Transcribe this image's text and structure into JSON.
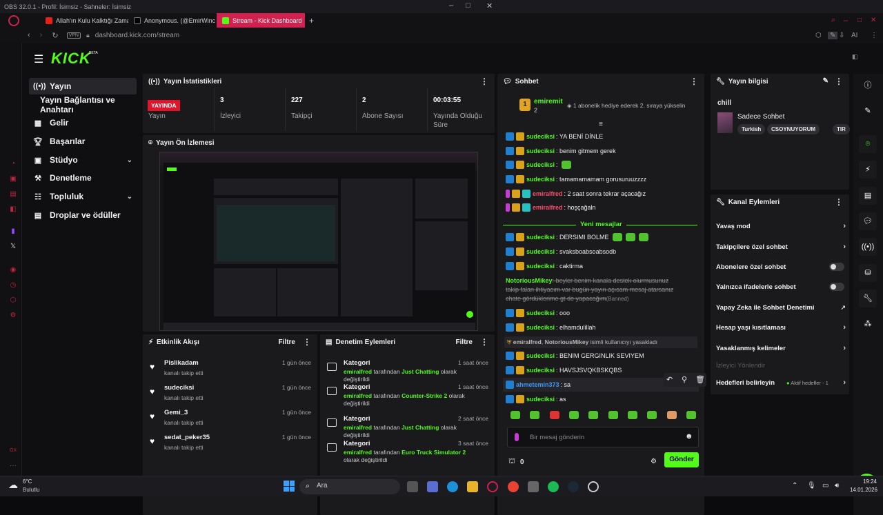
{
  "obs": {
    "title": "OBS 32.0.1 - Profil: İsimsiz - Sahneler: İsimsiz"
  },
  "browser": {
    "tabs": [
      {
        "label": "Allah'ın Kulu Kalktığı Zama"
      },
      {
        "label": "Anonymous. (@EmirWinc"
      },
      {
        "label": "Stream - Kick Dashboard"
      }
    ],
    "vpn": "VPN",
    "url": "dashboard.kick.com/stream",
    "ai": "AI"
  },
  "brand": {
    "logo": "KICK",
    "beta": "BETA",
    "accent": "#53fc18"
  },
  "sidebar": {
    "items": [
      {
        "label": "Yayın",
        "icon": "broadcast-icon"
      },
      {
        "label": "Yayın Bağlantısı ve Anahtarı"
      },
      {
        "label": "Gelir",
        "icon": "chart-icon"
      },
      {
        "label": "Başarılar",
        "icon": "trophy-icon"
      },
      {
        "label": "Stüdyo",
        "icon": "grid-icon"
      },
      {
        "label": "Denetleme",
        "icon": "hammer-icon"
      },
      {
        "label": "Topluluk",
        "icon": "community-icon"
      },
      {
        "label": "Droplar ve ödüller",
        "icon": "gift-icon"
      }
    ]
  },
  "stats": {
    "title": "Yayın İstatistikleri",
    "live_badge": "YAYINDA",
    "live_label": "Yayın",
    "items": [
      {
        "value": "3",
        "label": "İzleyici"
      },
      {
        "value": "227",
        "label": "Takipçi"
      },
      {
        "value": "2",
        "label": "Abone Sayısı"
      },
      {
        "value": "00:03:55",
        "label": "Yayında Olduğu Süre"
      }
    ]
  },
  "preview": {
    "title": "Yayın Ön İzlemesi"
  },
  "chat": {
    "title": "Sohbet",
    "pinned": {
      "user": "emiremit",
      "count": "2",
      "text": "1 abonelik hediye ederek 2. sıraya yükselin"
    },
    "new_messages": "Yeni mesajlar",
    "messages": [
      {
        "user": "sudeciksi",
        "text": ": YA BENİ DİNLE"
      },
      {
        "user": "sudeciksi",
        "text": ": benim gitmem gerek"
      },
      {
        "user": "sudeciksi",
        "text": ":"
      },
      {
        "user": "sudeciksi",
        "text": ": tamamamamam gorusuruuzzzz"
      },
      {
        "user": "emiralfred",
        "text": ": 2 saat sonra tekrar açacağız"
      },
      {
        "user": "emiralfred",
        "text": ": hoşçağaln"
      },
      {
        "user": "sudeciksi",
        "text": ": DERSIMI BOLME"
      },
      {
        "user": "sudeciksi",
        "text": ": svaksboabsoabsodb"
      },
      {
        "user": "sudeciksi",
        "text": ": caktirma"
      },
      {
        "user": "NotoriousMikey",
        "text": ": beyler benim kanala destek olurmusunuz takip falan ihtiyacım var bugün yayın açıcam mesaj atarsanız chate gördüklerime gt de yapacağım",
        "tag": "(Banned)"
      },
      {
        "user": "sudeciksi",
        "text": ": ooo"
      },
      {
        "user": "sudeciksi",
        "text": ": elhamdulillah"
      },
      {
        "user": "sudeciksi",
        "text": ": BENIM GERGINLIK SEVIYEM"
      },
      {
        "user": "sudeciksi",
        "text": ": HAVSJSVQKBSKQBS"
      },
      {
        "user": "ahmetemin373",
        "text": ": sa"
      },
      {
        "user": "sudeciksi",
        "text": ": as"
      }
    ],
    "system": {
      "user1": "emiralfred",
      "sep": ", ",
      "user2": "NotoriousMikey",
      "text": " isimli kullanıcıyı yasakladı"
    },
    "input_placeholder": "Bir mesaj gönderin",
    "points": "0",
    "send": "Gönder"
  },
  "info": {
    "title": "Yayın bilgisi",
    "stream_title": "chill",
    "category": "Sadece Sohbet",
    "tags": [
      "Turkish",
      "CSOYNUYORUM",
      "TIR"
    ]
  },
  "channel": {
    "title": "Kanal Eylemleri",
    "items": [
      {
        "label": "Yavaş mod"
      },
      {
        "label": "Takipçilere özel sohbet"
      },
      {
        "label": "Abonelere özel sohbet"
      },
      {
        "label": "Yalnızca ifadelerle sohbet"
      },
      {
        "label": "Yapay Zeka ile Sohbet Denetimi"
      },
      {
        "label": "Hesap yaşı kısıtlaması"
      },
      {
        "label": "Yasaklanmış kelimeler"
      },
      {
        "label": "İzleyici Yönlendir"
      },
      {
        "label": "Hedefleri belirleyin"
      }
    ],
    "goals_status": "Aktif hedefler - 1"
  },
  "feed": {
    "title": "Etkinlik Akışı",
    "filter": "Filtre",
    "items": [
      {
        "user": "Pislikadam",
        "action": "kanalı takip etti",
        "time": "1 gün önce"
      },
      {
        "user": "sudeciksi",
        "action": "kanalı takip etti",
        "time": "1 gün önce"
      },
      {
        "user": "Gemi_3",
        "action": "kanalı takip etti",
        "time": "1 gün önce"
      },
      {
        "user": "sedat_peker35",
        "action": "kanalı takip etti",
        "time": "1 gün önce"
      }
    ]
  },
  "mod": {
    "title": "Denetim Eylemleri",
    "filter": "Filtre",
    "items": [
      {
        "title": "Kategori",
        "user": "emiralfred",
        "mid": " tarafından ",
        "game": "Just Chatting",
        "end": " olarak değiştirildi",
        "time": "1 saat önce"
      },
      {
        "title": "Kategori",
        "user": "emiralfred",
        "mid": " tarafından ",
        "game": "Counter-Strike 2",
        "end": " olarak değiştirildi",
        "time": "1 saat önce"
      },
      {
        "title": "Kategori",
        "user": "emiralfred",
        "mid": " tarafından ",
        "game": "Just Chatting",
        "end": " olarak değiştirildi",
        "time": "2 saat önce"
      },
      {
        "title": "Kategori",
        "user": "emiralfred",
        "mid": " tarafından ",
        "game": "Euro Truck Simulator 2",
        "end": " olarak değiştirildi",
        "time": "3 saat önce"
      }
    ]
  },
  "taskbar": {
    "weather_temp": "6°C",
    "weather_desc": "Bulutlu",
    "search": "Ara",
    "time": "19:24",
    "date": "14.01.2026"
  }
}
